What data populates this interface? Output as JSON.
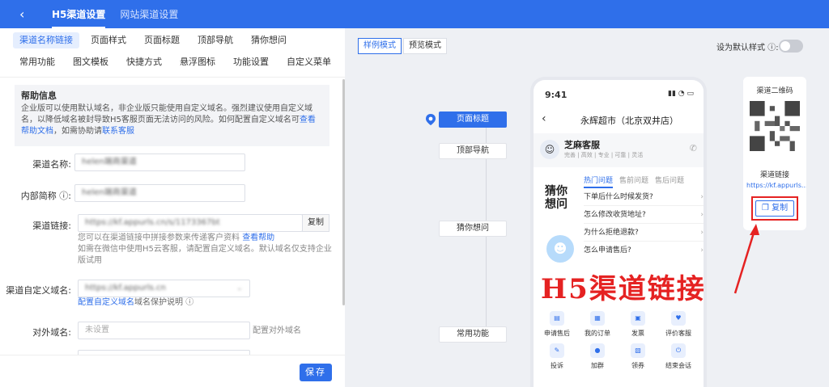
{
  "topbar": {
    "back_icon": "chevron-left-icon",
    "tabs": [
      {
        "label": "H5渠道设置"
      },
      {
        "label": "网站渠道设置"
      }
    ]
  },
  "left": {
    "tabs_row1": [
      "渠道名称链接",
      "页面样式",
      "页面标题",
      "顶部导航",
      "猜你想问"
    ],
    "tabs_row2": [
      "常用功能",
      "图文模板",
      "快捷方式",
      "悬浮图标",
      "功能设置",
      "自定义菜单"
    ],
    "help": {
      "title": "帮助信息",
      "text_before": "企业版可以使用默认域名，非企业版只能使用自定义域名。强烈建议使用自定义域名，以降低域名被封导致H5客服页面无法访问的风险。如何配置自定义域名可",
      "link1": "查看帮助文档",
      "text_mid": "，如需协助请",
      "link2": "联系客服"
    },
    "form": {
      "channel_name": {
        "label": "渠道名称:",
        "value": "helen端商渠道"
      },
      "internal_short": {
        "label": "内部简称",
        "value": "helen端商渠道"
      },
      "channel_link": {
        "label": "渠道链接:",
        "value": "https://kf.appurls.cn/s/1173367bt",
        "copy": "复制",
        "hint1": "您可以在渠道链接中拼接参数来传递客户资料",
        "hint1_link": "查看帮助",
        "hint2": "如需在微信中使用H5云客服，请配置自定义域名。默认域名仅支持企业版试用"
      },
      "custom_domain": {
        "label": "渠道自定义域名:",
        "value": "https://kf.appurls.cn",
        "link": "配置自定义域名",
        "protect": "域名保护说明"
      },
      "external_domain": {
        "label": "对外域名:",
        "placeholder": "未设置",
        "link": "配置对外域名"
      }
    },
    "save": "保存"
  },
  "right": {
    "modes": [
      "样例模式",
      "预览模式"
    ],
    "default_style": "设为默认样式",
    "nav_pills": [
      "页面标题",
      "顶部导航",
      "猜你想问",
      "常用功能"
    ],
    "phone": {
      "time": "9:41",
      "title": "永辉超市（北京双井店）",
      "agent_name": "芝麻客服",
      "agent_tags": "完善 | 高效 | 专业 | 可靠 | 灵活",
      "guess_title": "猜你想问",
      "faq_tabs": [
        "热门问题",
        "售前问题",
        "售后问题"
      ],
      "faqs": [
        "下单后什么时候发货?",
        "怎么修改收货地址?",
        "为什么拒绝退款?",
        "怎么申请售后?"
      ],
      "functions": [
        "申请售后",
        "我的订单",
        "发票",
        "评价客服",
        "投诉",
        "加群",
        "领券",
        "结束会话"
      ]
    },
    "qr": {
      "title": "渠道二维码",
      "link_title": "渠道链接",
      "link_value": "https://kf.appurls...",
      "copy": "复制"
    },
    "overlay_text": "H5渠道链接"
  }
}
